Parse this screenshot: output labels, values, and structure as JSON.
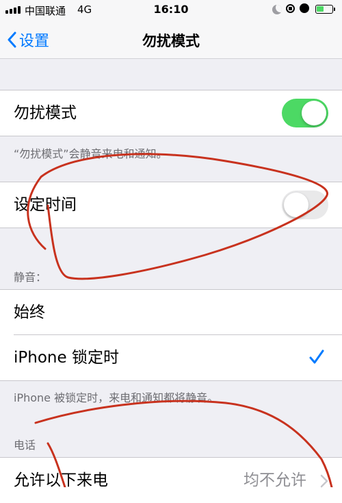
{
  "status_bar": {
    "carrier": "中国联通",
    "network": "4G",
    "time": "16:10",
    "icons": [
      "signal-icon",
      "moon-icon",
      "rotation-lock-icon",
      "alarm-icon",
      "battery-icon"
    ]
  },
  "nav": {
    "back_label": "设置",
    "title": "勿扰模式"
  },
  "dnd": {
    "label": "勿扰模式",
    "enabled": true,
    "footnote": "“勿扰模式”会静音来电和通知。"
  },
  "scheduled": {
    "label": "设定时间",
    "enabled": false
  },
  "silence": {
    "header": "静音：",
    "options": [
      {
        "label": "始终",
        "selected": false
      },
      {
        "label": "iPhone 锁定时",
        "selected": true
      }
    ],
    "footnote": "iPhone 被锁定时，来电和通知都将静音。"
  },
  "phone": {
    "header": "电话",
    "allow_calls_label": "允许以下来电",
    "allow_calls_value": "均不允许"
  },
  "colors": {
    "accent": "#007aff",
    "toggle_on": "#4cd964",
    "annotation_ink": "#c8321e"
  }
}
